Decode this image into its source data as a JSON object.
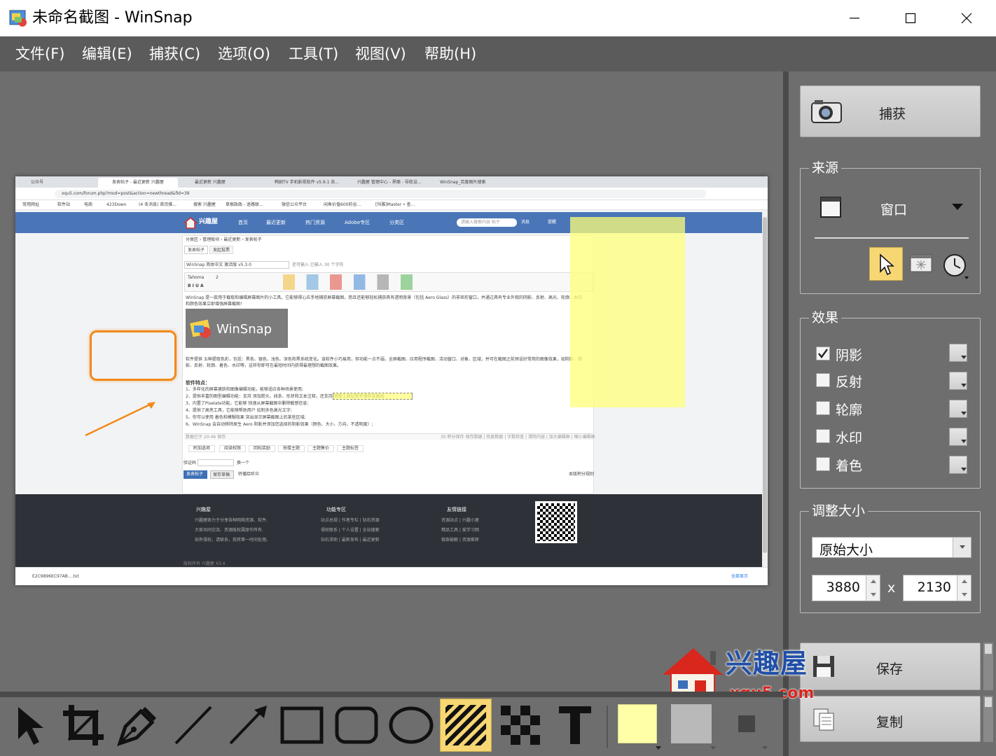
{
  "window": {
    "title": "未命名截图 - WinSnap"
  },
  "menu": [
    {
      "label": "文件(F)"
    },
    {
      "label": "编辑(E)"
    },
    {
      "label": "捕获(C)"
    },
    {
      "label": "选项(O)"
    },
    {
      "label": "工具(T)"
    },
    {
      "label": "视图(V)"
    },
    {
      "label": "帮助(H)"
    }
  ],
  "side": {
    "capture_label": "捕获",
    "source": {
      "legend": "来源",
      "mode": "窗口"
    },
    "effects": {
      "legend": "效果",
      "items": [
        {
          "label": "阴影",
          "checked": true
        },
        {
          "label": "反射",
          "checked": false
        },
        {
          "label": "轮廓",
          "checked": false
        },
        {
          "label": "水印",
          "checked": false
        },
        {
          "label": "着色",
          "checked": false
        }
      ]
    },
    "resize": {
      "legend": "调整大小",
      "mode": "原始大小",
      "width": "3880",
      "height": "2130",
      "times": "x"
    },
    "save_label": "保存",
    "copy_label": "复制"
  },
  "watermark": {
    "brand": "兴趣屋",
    "domain": "xqu5.com"
  },
  "colors": {
    "menubar": "#5b5b5b",
    "panel": "#6e6e6e",
    "highlight_tool": "#f7d774",
    "fill_color": "#ffffa8",
    "line_color": "#b9b9b9"
  },
  "screenshot": {
    "tabs": [
      {
        "label": "公众号"
      },
      {
        "label": "发表帖子 - 最近更新 兴趣屋"
      },
      {
        "label": "最近更新 兴趣屋"
      },
      {
        "label": "韩剧TV 手机影视软件 v5.9.1 去..."
      },
      {
        "label": "兴趣屋 管理中心 - 界面 - 导航设..."
      },
      {
        "label": "WinSnap_百度图片搜索"
      }
    ],
    "url": "xqu5.com/forum.php?mod=post&action=newthread&fid=39",
    "bookmarks": [
      "常用网址",
      "软件站",
      "电商",
      "423Down",
      "(4 条消息) 首页推...",
      "搜索 兴趣屋",
      "草根政政 - 迷路联...",
      "微信公众平台",
      "闲鱼价值600的谷...",
      "[玛雅]Master • 查..."
    ],
    "site_logo": "兴趣屋",
    "nav": [
      "首页",
      "最近更新",
      "热门资源",
      "Adobe专区",
      "分类区"
    ],
    "search_placeholder": "请输入搜索内容   帖子",
    "nav_right": [
      "消息",
      "提醒"
    ],
    "breadcrumb": "分类区 › 管理板块 › 最近更新 › 发表帖子",
    "post_tabs": [
      "发表帖子",
      "发起投票"
    ],
    "post_title": "WinSnap 简体中文 激活版 v5.3.0",
    "title_counter": "还可输入 已输入 30 个字符",
    "intro": "WinSnap 是一款用于截取和编辑屏幕图片的小工具。它能够得心应手地捕获屏幕截图，而且还能够轻松捕获具有透明背景（包括 Aero Glass）的非矩形窗口，并通过具有专业外观的阴影、反射、高光、轮廓、水印和颜色效果立即增强屏幕截图！",
    "logo_text": "WinSnap",
    "para2": "软件提供 五种提取色彩，包括：黑色、银色、浅色、深色和黑系统变化。该软件小巧易用，但功能一点不弱。全屏截图、应用程序截图、活动窗口、对象、区域，并可在截图之前预设好常用的图像效果，如阴影、倒影、反射、轮廓、着色、水印等，这样你即可在最短时间内获得最理想的截图效果。",
    "features_title": "软件特点：",
    "features": [
      "1、多样化的屏幕捕获和图像编辑功能，能够适应各种场景使用;",
      "2、提供丰富的图型编辑功能：支持 添加箭头、线条、形状和文本注释，还支持 钢笔工具绘制平滑样条曲线",
      "3、内置了Pixelate功能。它能够 快速从屏幕截图中删除敏感信息;",
      "4、提供了高亮工具，它能够帮助用户 绘制多色高光文字;",
      "5、你可以使用 着色和模糊效果 突出显示屏幕截图上的某些区域;",
      "6、WinSnap 会自动移除原生 Aero 阴影并添加您选择的阴影效果（颜色、大小、方向、不透明度）;"
    ],
    "status_left": "数据已于 20:46 保存",
    "status_right": "30 积分保存 保存数据 | 恢复数据 | 字数检查 | 清除内容 | 加大编辑框 | 缩小编辑框",
    "option_tabs": [
      "附加选项",
      "阅读权限",
      "回帖奖励",
      "抢楼主题",
      "主题售价",
      "主题标签"
    ],
    "captcha_label": "验证码",
    "captcha_change": "换一个",
    "submit_btn": "发表帖子",
    "draft_btn": "保存草稿",
    "sync_label": "转播给听众",
    "rules_link": "本版积分规则",
    "footer": {
      "col1_title": "兴趣屋",
      "col1_lines": [
        "兴趣屋致力于分享各种网络资源、软件,",
        "大家共同交流、资源版权属原作所有.",
        "如有侵权，请联系，我将第一时间处理。"
      ],
      "col2_title": "功能专区",
      "col2_lines": [
        "站点总规 | 作者专栏 | 钻石资源",
        "侵权联系 | 个人设置 | 全站搜索",
        "钻石求助 | 最新发布 | 最近更新"
      ],
      "col3_title": "友情链接",
      "col3_lines": [
        "资源站点 | 兴趣小屋",
        "精品工具 | 爱学习网",
        "极致破解 | 资源推荐"
      ],
      "copyright": "版权所有 兴趣屋 X3.4"
    },
    "download_file": "E2C9896EC97AB....txt",
    "download_all": "全部显示",
    "editor_font": "Tahoma",
    "editor_size": "2"
  }
}
